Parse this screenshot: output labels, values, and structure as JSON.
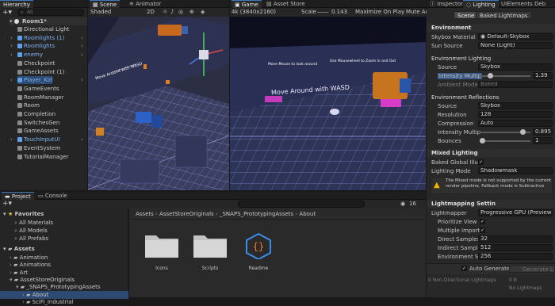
{
  "hierarchy": {
    "tab": "Hierarchy",
    "search_placeholder": "All",
    "scene": "Room1*",
    "items": [
      {
        "label": "Directional Light",
        "blue": false
      },
      {
        "label": "Roomlights (1)",
        "blue": true
      },
      {
        "label": "Roomlights",
        "blue": true
      },
      {
        "label": "enemy",
        "blue": true
      },
      {
        "label": "Checkpoint",
        "blue": false
      },
      {
        "label": "Checkpoint (1)",
        "blue": false
      },
      {
        "label": "Player_Kid",
        "blue": true
      },
      {
        "label": "GameEvents",
        "blue": false
      },
      {
        "label": "RoomManager",
        "blue": false
      },
      {
        "label": "Room",
        "blue": false
      },
      {
        "label": "Completion",
        "blue": false
      },
      {
        "label": "SwitchesGen",
        "blue": false
      },
      {
        "label": "GameAssets",
        "blue": false
      },
      {
        "label": "TouchInputUI",
        "blue": true
      },
      {
        "label": "EventSystem",
        "blue": false
      },
      {
        "label": "TutorialManager",
        "blue": false
      }
    ]
  },
  "scene_view": {
    "tab_scene": "Scene",
    "tab_animator": "Animator",
    "shading": "Shaded",
    "mode": "2D",
    "overlay_text": "Move Around with WASD"
  },
  "game_view": {
    "tab_game": "Game",
    "tab_store": "Asset Store",
    "resolution": "4k (3840x2160)",
    "scale_label": "Scale",
    "scale_value": "0.143",
    "maximize": "Maximize On Play",
    "mute": "Mute Audio",
    "hint_left": "Move Mouse to look around",
    "hint_right": "Use Mousewheel to Zoom in and Out",
    "hint_center": "Move Around with WASD"
  },
  "inspector": {
    "tab_inspector": "Inspector",
    "tab_lighting": "Lighting",
    "tab_uielements": "UIElements Deb",
    "btn_scene": "Scene",
    "btn_baked": "Baked Lightmaps",
    "environment": "Environment",
    "skybox_material_label": "Skybox Material",
    "skybox_material_value": "Default-Skybox",
    "sun_source_label": "Sun Source",
    "sun_source_value": "None (Light)",
    "env_lighting": "Environment Lighting",
    "source_label": "Source",
    "source_value": "Skybox",
    "intensity_label": "Intensity Multip",
    "intensity_value": "1.39",
    "intensity_fraction": 0.17,
    "ambient_label": "Ambient Mode",
    "ambient_value": "Baked",
    "env_reflections": "Environment Reflections",
    "ref_source_label": "Source",
    "ref_source_value": "Skybox",
    "resolution_label": "Resolution",
    "resolution_value": "128",
    "compression_label": "Compression",
    "compression_value": "Auto",
    "ref_intensity_label": "Intensity Multip",
    "ref_intensity_value": "0.895",
    "ref_intensity_fraction": 0.9,
    "bounces_label": "Bounces",
    "bounces_value": "1",
    "bounces_fraction": 0.0,
    "mixed_lighting": "Mixed Lighting",
    "baked_gi_label": "Baked Global Illun",
    "lighting_mode_label": "Lighting Mode",
    "lighting_mode_value": "Shadowmask",
    "warning": "The Mixed mode is not supported by the current render pipeline. Fallback mode is Subtractive",
    "lightmapping": "Lightmapping Settin",
    "lightmapper_label": "Lightmapper",
    "lightmapper_value": "Progressive GPU (Preview)",
    "prioritize_label": "Prioritize View",
    "multiple_label": "Multiple Importa",
    "direct_label": "Direct Samples",
    "direct_value": "32",
    "indirect_label": "Indirect Sample",
    "indirect_value": "512",
    "env_samples_label": "Environment Sa",
    "env_samples_value": "256",
    "auto_generate": "Auto Generate",
    "generate_btn": "Generate Ligh",
    "non_directional": "0 Non-Directional Lightmaps",
    "size": "0 B",
    "no_lightmaps": "No Lightmaps"
  },
  "project": {
    "tab_project": "Project",
    "tab_console": "Console",
    "hidden_count": "16",
    "favorites": "Favorites",
    "fav_items": [
      "All Materials",
      "All Models",
      "All Prefabs"
    ],
    "assets": "Assets",
    "asset_items": [
      {
        "label": "Animation",
        "indent": 1
      },
      {
        "label": "Animations",
        "indent": 1
      },
      {
        "label": "Art",
        "indent": 1
      },
      {
        "label": "AssetStoreOriginals",
        "indent": 1
      },
      {
        "label": "_SNAPS_PrototypingAssets",
        "indent": 2
      },
      {
        "label": "About",
        "indent": 3
      },
      {
        "label": "SciFi_Industrial",
        "indent": 3
      }
    ],
    "breadcrumb": [
      "Assets",
      "AssetStoreOriginals",
      "_SNAPS_PrototypingAssets",
      "About"
    ],
    "files": [
      {
        "label": "Icons",
        "kind": "folder"
      },
      {
        "label": "Scripts",
        "kind": "folder"
      },
      {
        "label": "Readme",
        "kind": "script"
      }
    ]
  },
  "colors": {
    "accent": "#3a79bb",
    "blue_text": "#7fb4f5",
    "panel": "#282828"
  }
}
